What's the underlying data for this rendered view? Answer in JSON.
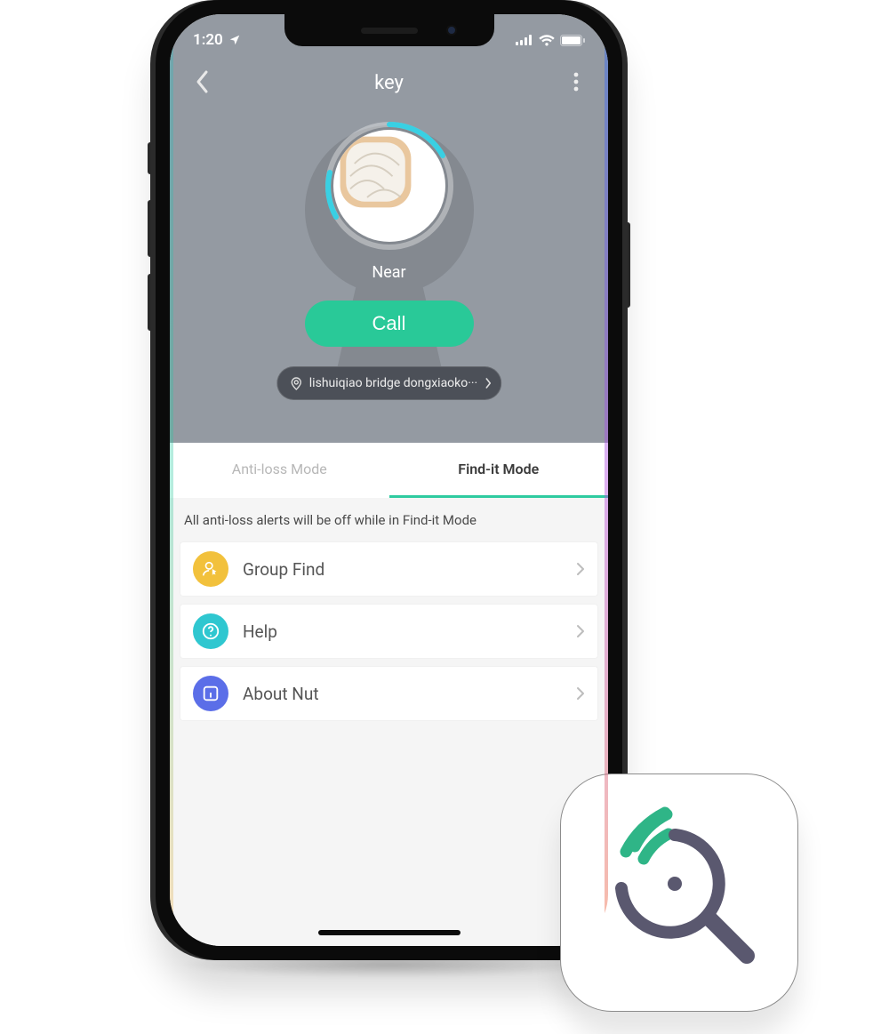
{
  "status": {
    "time": "1:20"
  },
  "nav": {
    "title": "key"
  },
  "device": {
    "proximity": "Near",
    "call_label": "Call",
    "location": "lishuiqiao bridge dongxiaoko···"
  },
  "tabs": {
    "anti_loss": "Anti-loss Mode",
    "find_it": "Find-it Mode",
    "active": "find_it"
  },
  "note": "All anti-loss alerts will be off while in Find-it Mode",
  "rows": {
    "group_find": "Group Find",
    "help": "Help",
    "about": "About Nut"
  },
  "colors": {
    "accent": "#29c998",
    "hero": "#949aa2"
  }
}
